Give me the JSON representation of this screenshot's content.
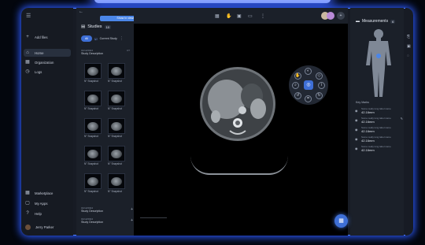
{
  "sidebar": {
    "menu_icon": "menu-icon",
    "items": [
      {
        "label": "Add files",
        "icon": "+"
      },
      {
        "label": "Home",
        "icon": "⌂"
      },
      {
        "label": "Organization",
        "icon": "▦"
      },
      {
        "label": "Logs",
        "icon": "◷"
      }
    ],
    "bottom_items": [
      {
        "label": "Marketplace",
        "icon": "▦"
      },
      {
        "label": "My Apps",
        "icon": "▢"
      },
      {
        "label": "Help",
        "icon": "?"
      }
    ],
    "user_name": "Jerry Parker"
  },
  "studies": {
    "top_badge": "Show in viewer",
    "title": "Studies",
    "count": "10",
    "filter_all": "All",
    "filter_current": "Current Study",
    "study_date": "01/12/2024",
    "study_tag": "CT",
    "study_label": "Study Description",
    "snapshot_label": "N° Snapshot",
    "collapsed_label": "Study Description",
    "add_label": "+ Add"
  },
  "measurements": {
    "title": "Measurements",
    "count": "6",
    "header": "Key Marks",
    "item_desc": "Some really long label name",
    "item_value": "42.16mm"
  },
  "colors": {
    "accent": "#3e6fd6",
    "frame_glow": "#2d5bff"
  }
}
